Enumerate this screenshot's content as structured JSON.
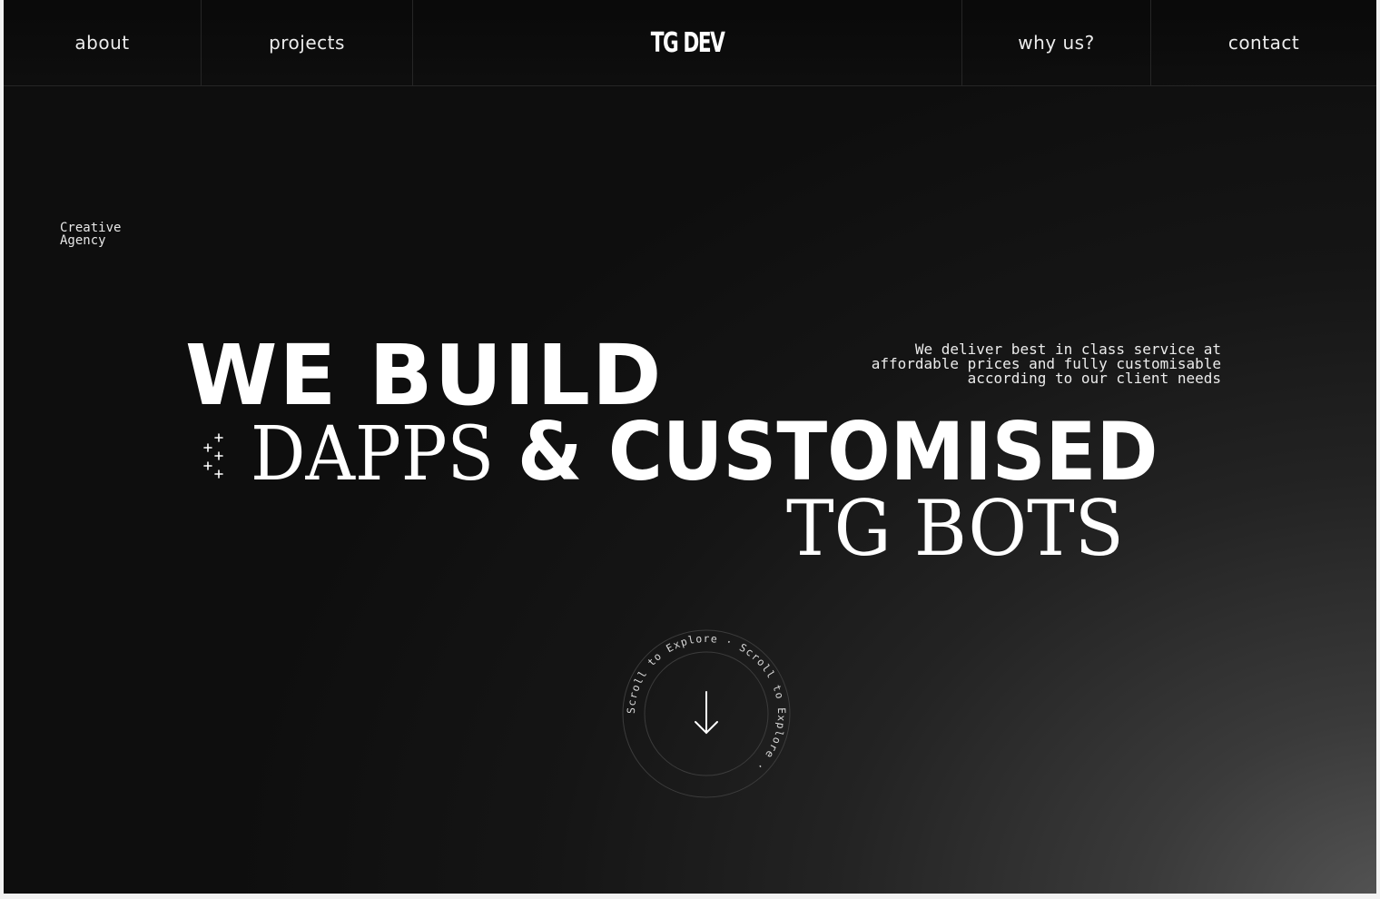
{
  "nav": {
    "about": "about",
    "projects": "projects",
    "logo": "TG DEV",
    "why_us": "why us?",
    "contact": "contact"
  },
  "hero": {
    "agency_line1": "Creative",
    "agency_line2": "Agency",
    "line1": "WE BUILD",
    "line2_light": "DAPPS",
    "line2_bold": "& CUSTOMISED",
    "line3": "TG BOTS",
    "tagline_line1": "We deliver best in class service at",
    "tagline_line2": "affordable prices and fully customisable",
    "tagline_line3": "according to our client needs"
  },
  "scroll": {
    "ring_text": "Scroll to Explore · Scroll to Explore · "
  },
  "icons": {
    "sparkles": "sparkles-icon",
    "scroll_arrow": "arrow-down-icon"
  },
  "colors": {
    "background_dark": "#0e0e0e",
    "background_light": "#565656",
    "text": "#ffffff",
    "divider": "#262626"
  }
}
